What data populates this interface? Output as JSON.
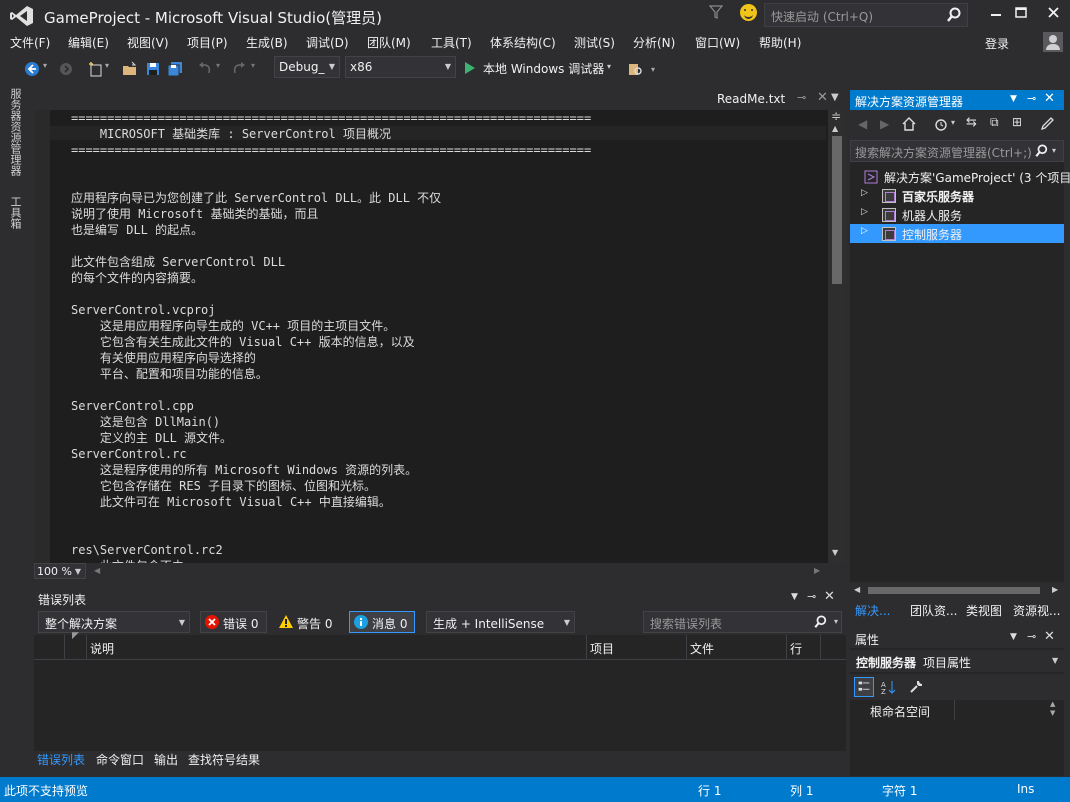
{
  "window": {
    "title": "GameProject - Microsoft Visual Studio(管理员)",
    "quick_launch_placeholder": "快速启动 (Ctrl+Q)"
  },
  "menu": {
    "items": [
      "文件(F)",
      "编辑(E)",
      "视图(V)",
      "项目(P)",
      "生成(B)",
      "调试(D)",
      "团队(M)",
      "工具(T)",
      "体系结构(C)",
      "测试(S)",
      "分析(N)",
      "窗口(W)",
      "帮助(H)"
    ],
    "login": "登录"
  },
  "toolbar": {
    "config": "Debug_",
    "platform": "x86",
    "run_label": "本地 Windows 调试器"
  },
  "left_tabs": [
    "服务器资源管理器",
    "工具箱"
  ],
  "editor": {
    "tab_label": "ReadMe.txt",
    "zoom": "100 %",
    "lines": [
      "========================================================================",
      "    MICROSOFT 基础类库 : ServerControl 项目概况",
      "========================================================================",
      "",
      "",
      "应用程序向导已为您创建了此 ServerControl DLL。此 DLL 不仅",
      "说明了使用 Microsoft 基础类的基础，而且",
      "也是编写 DLL 的起点。",
      "",
      "此文件包含组成 ServerControl DLL",
      "的每个文件的内容摘要。",
      "",
      "ServerControl.vcproj",
      "    这是用应用程序向导生成的 VC++ 项目的主项目文件。",
      "    它包含有关生成此文件的 Visual C++ 版本的信息，以及",
      "    有关使用应用程序向导选择的",
      "    平台、配置和项目功能的信息。",
      "",
      "ServerControl.cpp",
      "    这是包含 DllMain()",
      "    定义的主 DLL 源文件。",
      "ServerControl.rc",
      "    这是程序使用的所有 Microsoft Windows 资源的列表。",
      "    它包含存储在 RES 子目录下的图标、位图和光标。",
      "    此文件可在 Microsoft Visual C++ 中直接编辑。",
      "",
      "",
      "res\\ServerControl.rc2",
      "    此文件包含不由"
    ]
  },
  "error_list": {
    "title": "错误列表",
    "scope": "整个解决方案",
    "errors_label": "错误 0",
    "warnings_label": "警告 0",
    "messages_label": "消息 0",
    "source_filter": "生成 + IntelliSense",
    "search_placeholder": "搜索错误列表",
    "columns": [
      "说明",
      "项目",
      "文件",
      "行"
    ],
    "bottom_tabs": [
      "错误列表",
      "命令窗口",
      "输出",
      "查找符号结果"
    ]
  },
  "solution_explorer": {
    "title": "解决方案资源管理器",
    "search_placeholder": "搜索解决方案资源管理器(Ctrl+;)",
    "solution_label": "解决方案'GameProject' (3 个项目",
    "projects": [
      "百家乐服务器",
      "机器人服务",
      "控制服务器"
    ],
    "selected_index": 2,
    "bottom_tabs": [
      "解决...",
      "团队资...",
      "类视图",
      "资源视..."
    ]
  },
  "properties": {
    "title": "属性",
    "object_name": "控制服务器",
    "object_type": "项目属性",
    "row_label": "根命名空间"
  },
  "status": {
    "message": "此项不支持预览",
    "line": "行 1",
    "col": "列 1",
    "ch": "字符 1",
    "mode": "Ins"
  },
  "colors": {
    "accent": "#007acc",
    "selection": "#3399ff",
    "background": "#2d2d30",
    "editor_bg": "#1e1e1e"
  }
}
